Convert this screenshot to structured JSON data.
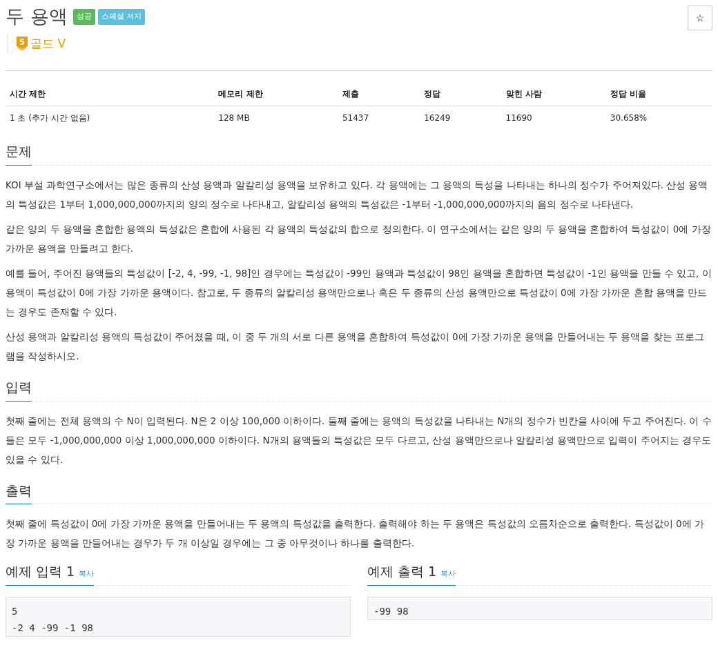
{
  "title": "두 용액",
  "badges": [
    {
      "label": "성공",
      "color": "#5cb85c"
    },
    {
      "label": "스페셜 저지",
      "color": "#5bc0de"
    }
  ],
  "favorite_button": {
    "label": "☆"
  },
  "tier": {
    "level": "5",
    "label": "골드 V"
  },
  "info_table": {
    "columns": [
      "시간 제한",
      "메모리 제한",
      "제출",
      "정답",
      "맞힌 사람",
      "정답 비율"
    ],
    "rows": [
      [
        "1 초 (추가 시간 없음)",
        "128 MB",
        "51437",
        "16249",
        "11690",
        "30.658%"
      ]
    ]
  },
  "sections": [
    {
      "heading": "문제",
      "paragraphs": [
        "KOI 부설 과학연구소에서는 많은 종류의 산성 용액과 알칼리성 용액을 보유하고 있다. 각 용액에는 그 용액의 특성을 나타내는 하나의 정수가 주어져있다. 산성 용액의 특성값은 1부터 1,000,000,000까지의 양의 정수로 나타내고, 알칼리성 용액의 특성값은 -1부터 -1,000,000,000까지의 음의 정수로 나타낸다.",
        "같은 양의 두 용액을 혼합한 용액의 특성값은 혼합에 사용된 각 용액의 특성값의 합으로 정의한다. 이 연구소에서는 같은 양의 두 용액을 혼합하여 특성값이 0에 가장 가까운 용액을 만들려고 한다.",
        "예를 들어, 주어진 용액들의 특성값이 [-2, 4, -99, -1, 98]인 경우에는 특성값이 -99인 용액과 특성값이 98인 용액을 혼합하면 특성값이 -1인 용액을 만들 수 있고, 이 용액이 특성값이 0에 가장 가까운 용액이다. 참고로, 두 종류의 알칼리성 용액만으로나 혹은 두 종류의 산성 용액만으로 특성값이 0에 가장 가까운 혼합 용액을 만드는 경우도 존재할 수 있다.",
        "산성 용액과 알칼리성 용액의 특성값이 주어졌을 때, 이 중 두 개의 서로 다른 용액을 혼합하여 특성값이 0에 가장 가까운 용액을 만들어내는 두 용액을 찾는 프로그램을 작성하시오."
      ]
    },
    {
      "heading": "입력",
      "paragraphs": [
        "첫째 줄에는 전체 용액의 수 N이 입력된다. N은 2 이상 100,000 이하이다. 둘째 줄에는 용액의 특성값을 나타내는 N개의 정수가 빈칸을 사이에 두고 주어진다. 이 수들은 모두 -1,000,000,000 이상 1,000,000,000 이하이다. N개의 용액들의 특성값은 모두 다르고, 산성 용액만으로나 알칼리성 용액만으로 입력이 주어지는 경우도 있을 수 있다."
      ]
    },
    {
      "heading": "출력",
      "paragraphs": [
        "첫째 줄에 특성값이 0에 가장 가까운 용액을 만들어내는 두 용액의 특성값을 출력한다. 출력해야 하는 두 용액은 특성값의 오름차순으로 출력한다. 특성값이 0에 가장 가까운 용액을 만들어내는 경우가 두 개 이상일 경우에는 그 중 아무것이나 하나를 출력한다."
      ]
    }
  ],
  "examples": [
    {
      "heading": "예제 입력 1",
      "copy_link": "복사",
      "lines": [
        "5",
        "-2 4 -99 -1 98"
      ]
    },
    {
      "heading": "예제 출력 1",
      "copy_link": "복사",
      "lines": [
        "-99 98"
      ]
    }
  ]
}
